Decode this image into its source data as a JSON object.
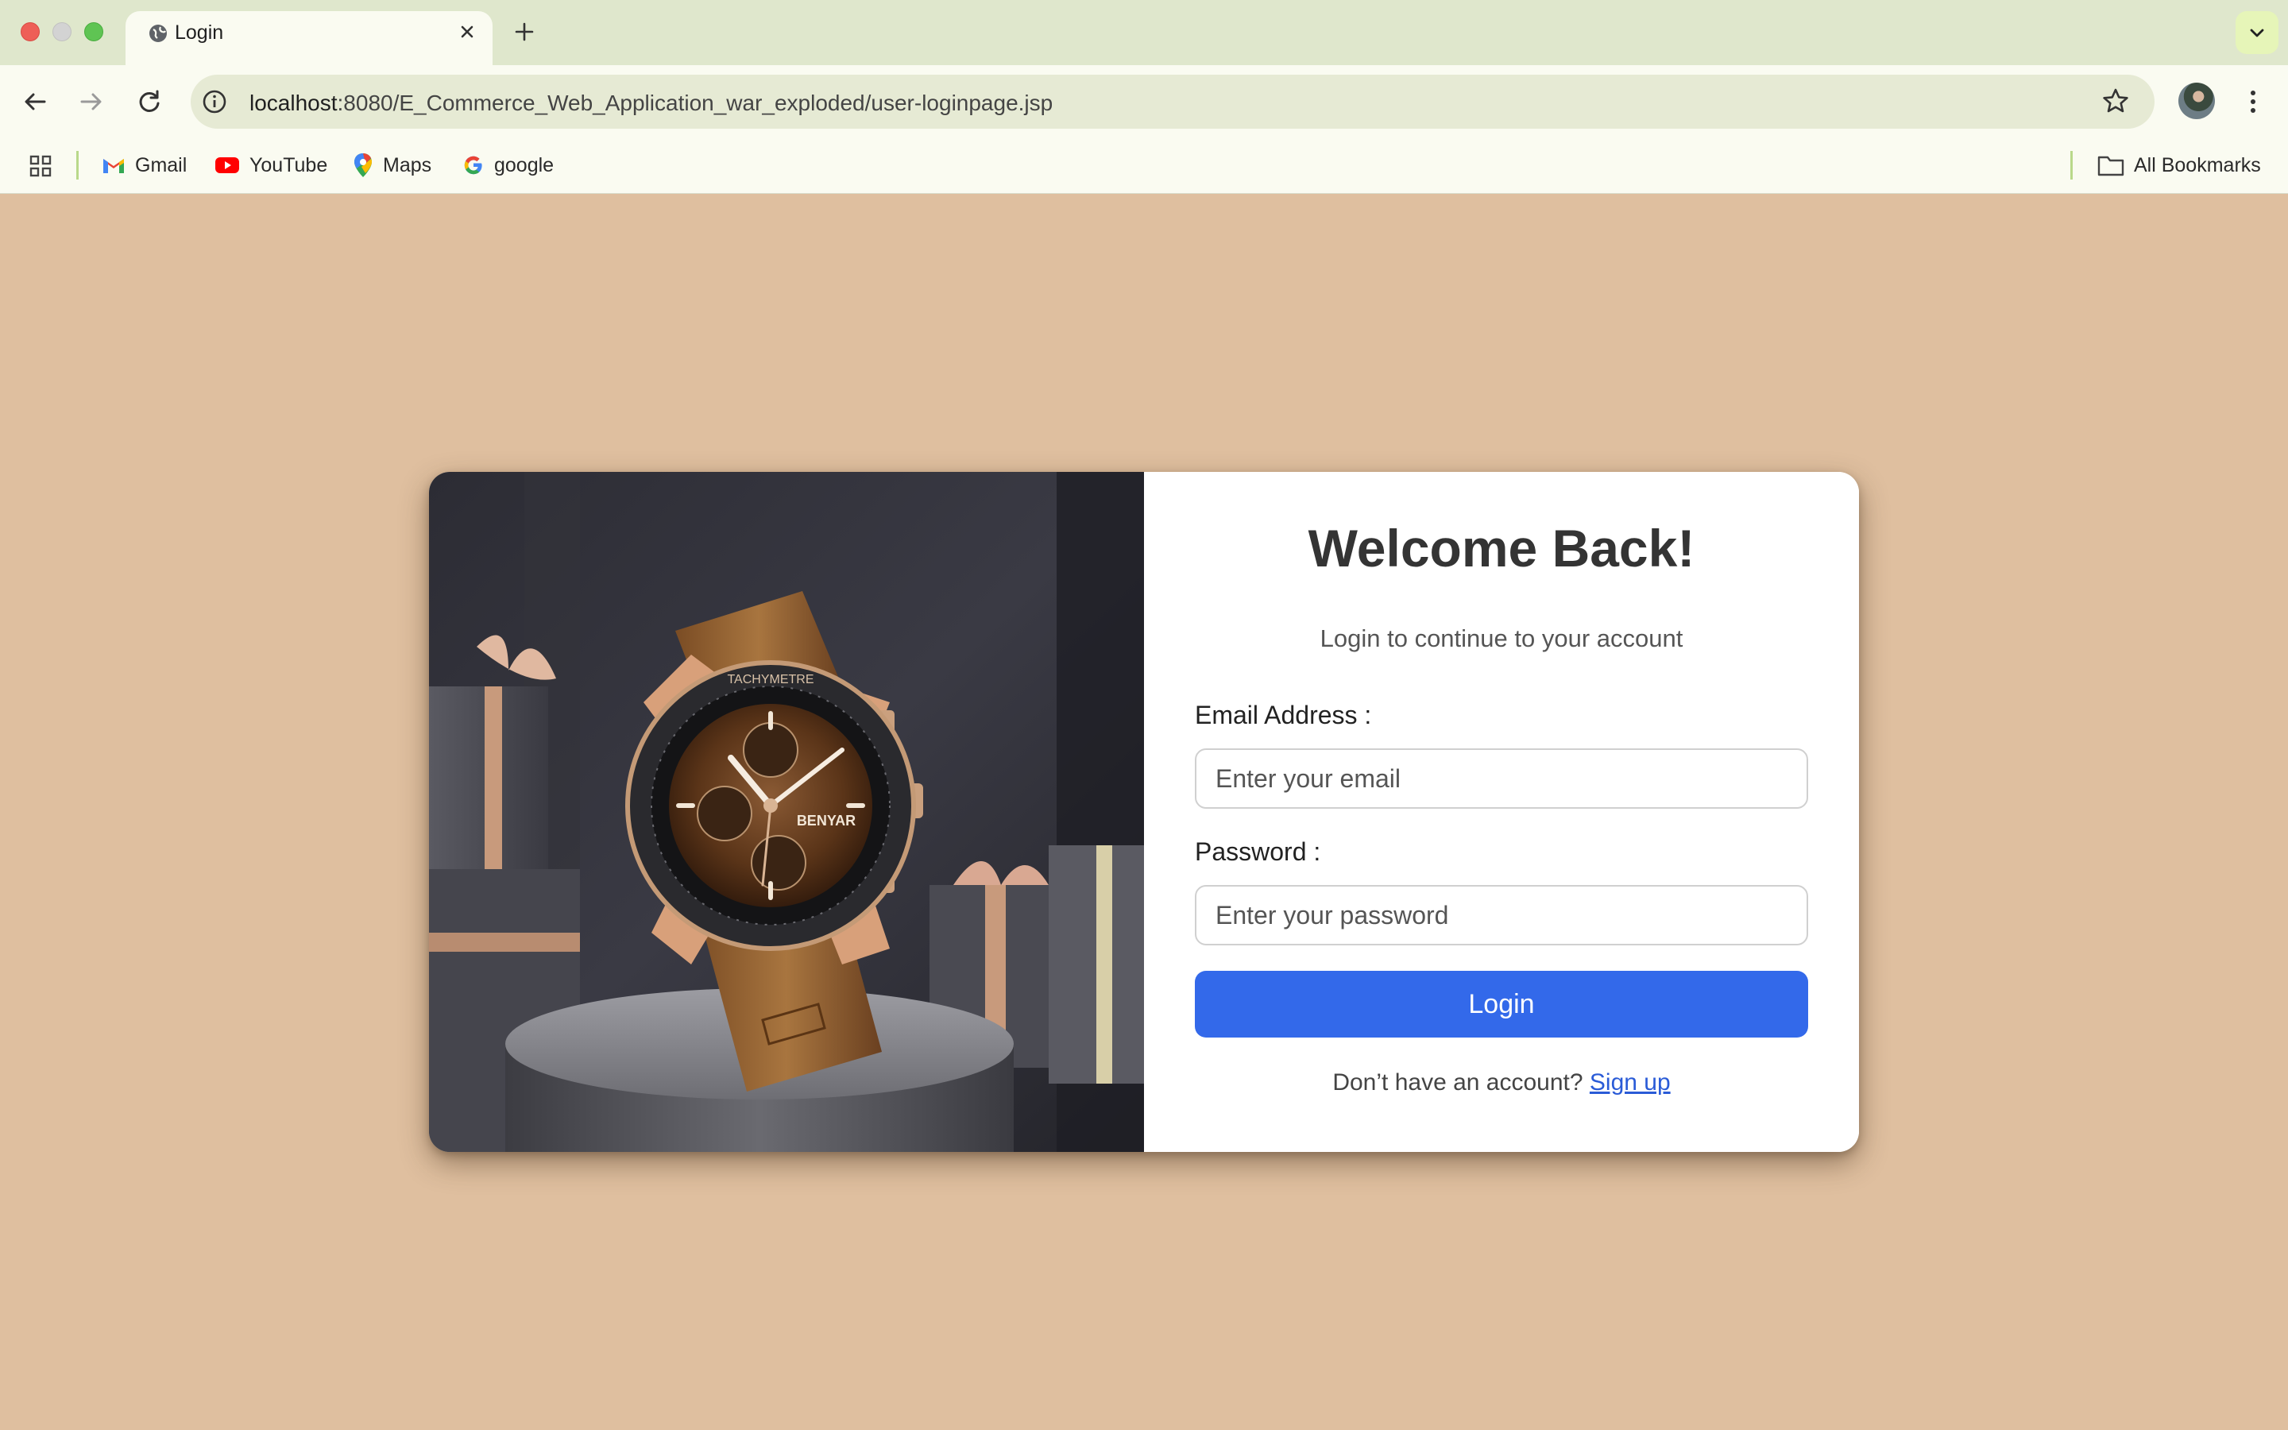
{
  "browser": {
    "tab": {
      "title": "Login",
      "icon": "globe-icon"
    },
    "url": {
      "host": "localhost",
      "rest": ":8080/E_Commerce_Web_Application_war_exploded/user-loginpage.jsp"
    },
    "bookmarks": [
      {
        "label": "Gmail",
        "icon": "gmail-icon"
      },
      {
        "label": "YouTube",
        "icon": "youtube-icon"
      },
      {
        "label": "Maps",
        "icon": "maps-icon"
      },
      {
        "label": "google",
        "icon": "google-icon"
      }
    ],
    "all_bookmarks": "All Bookmarks"
  },
  "page": {
    "background": "#dfbf9f",
    "image": {
      "subject": "watch-photo",
      "brand": "BENYAR",
      "bezel_text": "TACHYMETRE"
    },
    "title": "Welcome Back!",
    "subtitle": "Login to continue to your account",
    "email": {
      "label": "Email Address :",
      "placeholder": "Enter your email"
    },
    "password": {
      "label": "Password :",
      "placeholder": "Enter your password"
    },
    "login_button": "Login",
    "signup_prompt": "Don’t have an account?",
    "signup_link": "Sign up",
    "accent": "#3369ea"
  }
}
